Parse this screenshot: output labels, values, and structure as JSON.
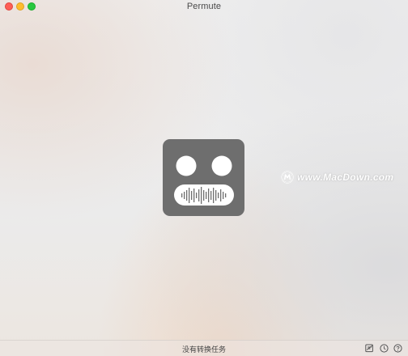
{
  "window": {
    "title": "Permute"
  },
  "main": {
    "logo_icon": "robot-audio-icon",
    "watermark": "www.MacDown.com"
  },
  "statusbar": {
    "text": "没有转换任务",
    "icons": [
      "presets-icon",
      "history-clock-icon",
      "help-icon"
    ]
  },
  "colors": {
    "close": "#fe5f57",
    "minimize": "#febc2e",
    "maximize": "#28c840",
    "robot": "#6e6e6e"
  }
}
